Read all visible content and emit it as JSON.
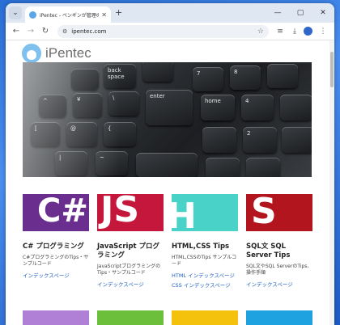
{
  "browser": {
    "tab_title": "iPentec - ペンギンが管理の技術サ",
    "url": "ipentec.com",
    "window_controls": [
      "minimize",
      "restore",
      "close"
    ]
  },
  "site": {
    "logo_text": "iPentec"
  },
  "hero": {
    "keys": [
      "back space",
      "enter",
      "home",
      "7",
      "8",
      "4",
      "2",
      "¥",
      "\\",
      "^",
      "~",
      "[",
      "{",
      "@",
      "|"
    ]
  },
  "cards": [
    {
      "title": "C# プログラミング",
      "desc": "C#プログラミングのTips・サンプルコード",
      "links": [
        "インデックスページ"
      ],
      "color": "#6a2e8f",
      "glyph": "C#"
    },
    {
      "title": "JavaScript プログラミング",
      "desc": "JavaScriptプログラミングのTips・サンプルコード",
      "links": [
        "インデックスページ"
      ],
      "color": "#c4173b",
      "glyph": "JS"
    },
    {
      "title": "HTML,CSS Tips",
      "desc": "HTML,CSSのTips サンプルコード",
      "links": [
        "HTML インデックスページ",
        "CSS インデックスページ"
      ],
      "color": "#49d3c8",
      "glyph": "H"
    },
    {
      "title": "SQL文 SQL Server Tips",
      "desc": "SQL文やSQL ServerのTips、操作手順",
      "links": [
        "インデックスページ"
      ],
      "color": "#b3151f",
      "glyph": "S"
    }
  ],
  "bottom_tiles": [
    "#b07fd6",
    "#6cbf3a",
    "#f4c20d",
    "#1ea2e0"
  ]
}
